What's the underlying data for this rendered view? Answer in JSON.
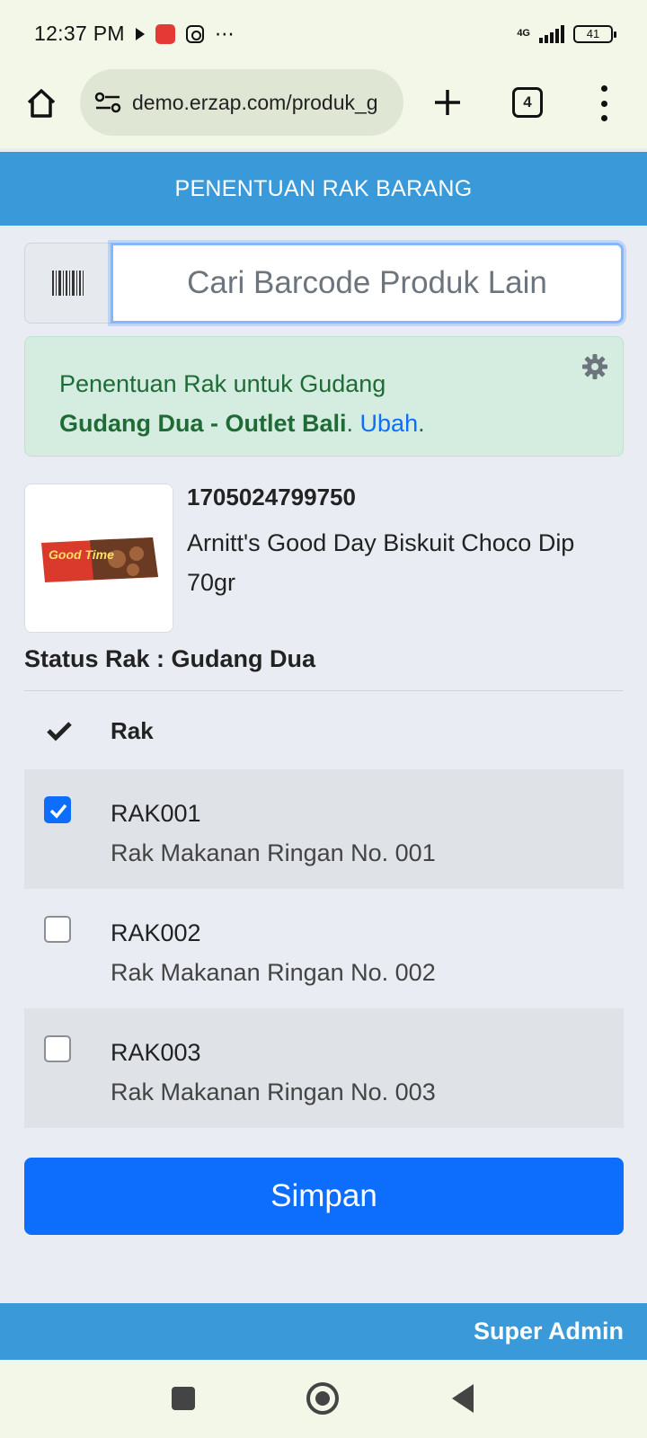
{
  "status_bar": {
    "time": "12:37 PM",
    "dots": "⋯",
    "network": "4G",
    "battery": "41",
    "icons": [
      "play-icon",
      "app-notification-icon",
      "instagram-icon",
      "more-icon",
      "signal-icon",
      "battery-icon"
    ]
  },
  "browser": {
    "url": "demo.erzap.com/produk_g",
    "tab_count": "4",
    "icons": [
      "home-icon",
      "site-settings-icon",
      "new-tab-icon",
      "tabs-icon",
      "menu-icon"
    ]
  },
  "header": {
    "title": "PENENTUAN RAK BARANG"
  },
  "search": {
    "placeholder": "Cari Barcode Produk Lain",
    "value": "",
    "icon": "barcode-icon"
  },
  "alert": {
    "line1": "Penentuan Rak untuk Gudang",
    "warehouse": "Gudang Dua - Outlet Bali",
    "after_warehouse": ".",
    "change_link": "Ubah",
    "end": ".",
    "icon": "gear-icon"
  },
  "product": {
    "barcode": "1705024799750",
    "name": "Arnitt's Good Day Biskuit Choco Dip 70gr",
    "image_text": "Good Time"
  },
  "status_rak": "Status Rak : Gudang Dua",
  "table": {
    "header_label": "Rak",
    "rows": [
      {
        "code": "RAK001",
        "desc": "Rak Makanan Ringan No. 001",
        "checked": true
      },
      {
        "code": "RAK002",
        "desc": "Rak Makanan Ringan No. 002",
        "checked": false
      },
      {
        "code": "RAK003",
        "desc": "Rak Makanan Ringan No. 003",
        "checked": false
      }
    ]
  },
  "save_button": "Simpan",
  "footer": {
    "user": "Super Admin"
  },
  "colors": {
    "header": "#3a9ad9",
    "primary": "#0d6efd",
    "alert_bg": "#d4ede0",
    "alert_text": "#1f6b36",
    "page_bg": "#e9edf3",
    "system_bar": "#f3f7e8"
  }
}
